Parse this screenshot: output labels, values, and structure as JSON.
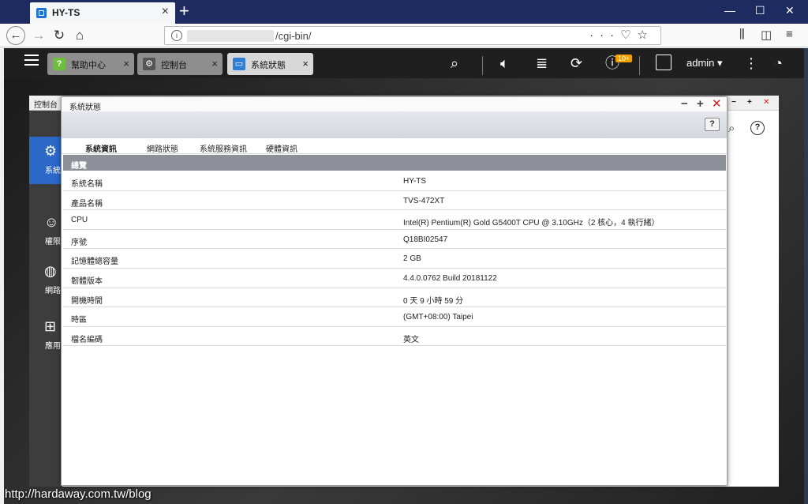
{
  "browser": {
    "tab_title": "HY-TS",
    "url_path": "/cgi-bin/",
    "window_controls": [
      "—",
      "☐",
      "✕"
    ]
  },
  "qts": {
    "tabs": [
      {
        "label": "幫助中心",
        "icon": "help-center-icon",
        "color": "#6bbf3c"
      },
      {
        "label": "控制台",
        "icon": "gear-icon",
        "color": "#555555"
      },
      {
        "label": "系統狀態",
        "icon": "monitor-icon",
        "color": "#2f7fd6"
      }
    ],
    "notification_badge": "10+",
    "user": "admin"
  },
  "control_panel": {
    "title": "控制台",
    "sidebar": [
      {
        "label": "系統",
        "icon": "gear-icon"
      },
      {
        "label": "權限",
        "icon": "user-icon"
      },
      {
        "label": "網路＆檔案服務",
        "icon": "globe-icon"
      },
      {
        "label": "應用服務",
        "icon": "apps-icon"
      }
    ]
  },
  "window": {
    "title": "系統狀態",
    "tabs": [
      "系統資訊",
      "網路狀態",
      "系統服務資訊",
      "硬體資訊"
    ],
    "active_tab": 0,
    "section_title": "總覽",
    "rows": [
      {
        "key": "系統名稱",
        "value": "HY-TS"
      },
      {
        "key": "產品名稱",
        "value": "TVS-472XT"
      },
      {
        "key": "CPU",
        "value": "Intel(R) Pentium(R) Gold G5400T CPU @ 3.10GHz（2 核心，4 執行緒）"
      },
      {
        "key": "序號",
        "value": "Q18BI02547"
      },
      {
        "key": "記憶體總容量",
        "value": "2 GB"
      },
      {
        "key": "韌體版本",
        "value": "4.4.0.0762 Build 20181122"
      },
      {
        "key": "開機時間",
        "value": "0 天 9 小時 59 分"
      },
      {
        "key": "時區",
        "value": "(GMT+08:00) Taipei"
      },
      {
        "key": "檔名編碼",
        "value": "英文"
      }
    ]
  },
  "watermark": "http://hardaway.com.tw/blog"
}
